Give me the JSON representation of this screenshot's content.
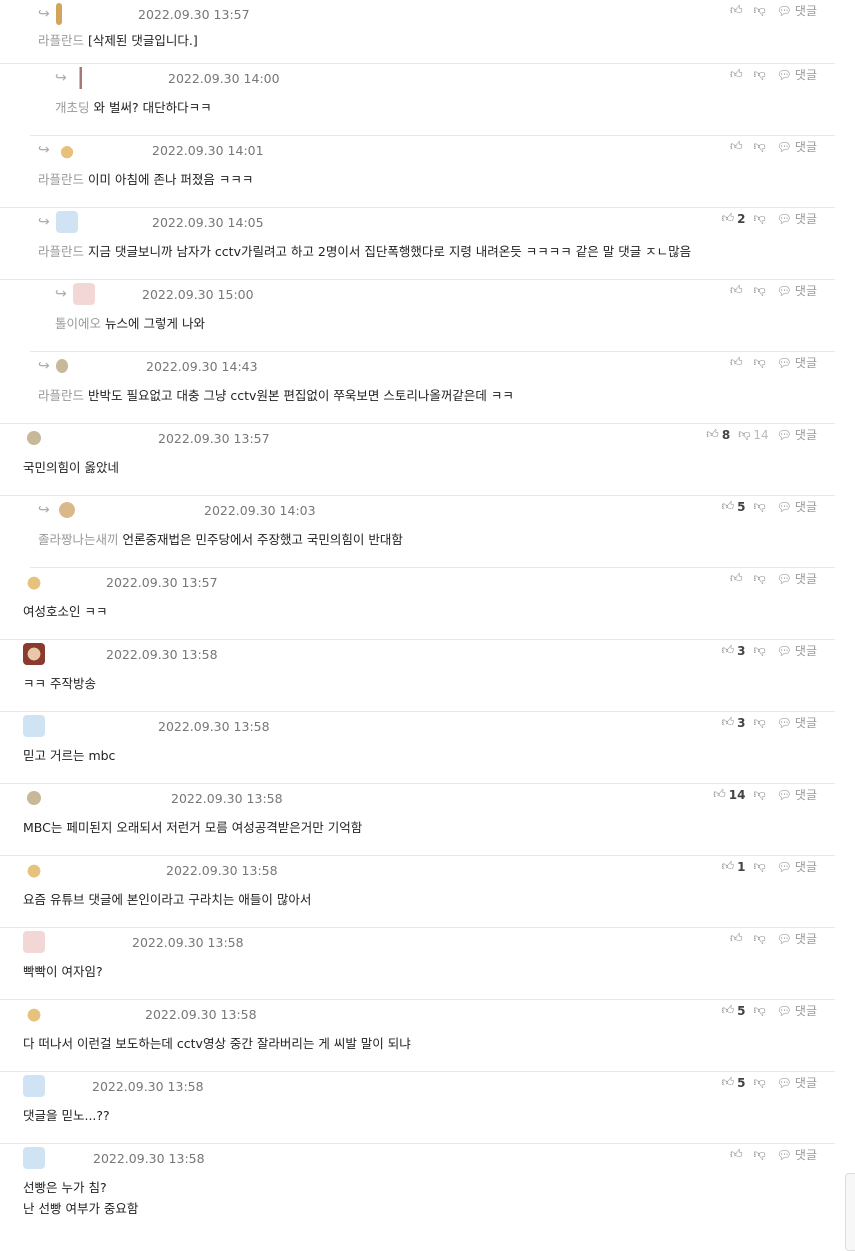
{
  "icons": {
    "like": "thumbs-up-icon",
    "dislike": "thumbs-down-icon",
    "reply": "speech-bubble-icon"
  },
  "reply_label": "댓글",
  "comments": [
    {
      "date": "2022.09.30 13:57",
      "nick": "라플란드",
      "text": "[삭제된 댓글입니다.]",
      "likes": "",
      "dislikes": ""
    },
    {
      "date": "2022.09.30 14:00",
      "nick": "개초딩",
      "text": "와 벌써? 대단하다ㅋㅋ",
      "likes": "",
      "dislikes": ""
    },
    {
      "date": "2022.09.30 14:01",
      "nick": "라플란드",
      "text": "이미 아침에 존나 퍼졌음 ㅋㅋㅋ",
      "likes": "",
      "dislikes": ""
    },
    {
      "date": "2022.09.30 14:05",
      "nick": "라플란드",
      "text": "지금 댓글보니까 남자가 cctv가릴려고 하고 2명이서 집단폭행했다로 지령 내려온듯 ㅋㅋㅋㅋ 같은 말 댓글 ㅈㄴ많음",
      "likes": "2",
      "dislikes": ""
    },
    {
      "date": "2022.09.30 15:00",
      "nick": "톨이에오",
      "text": "뉴스에 그렇게 나와",
      "likes": "",
      "dislikes": ""
    },
    {
      "date": "2022.09.30 14:43",
      "nick": "라플란드",
      "text": "반박도 필요없고 대충 그냥 cctv원본 편집없이 쭈욱보면 스토리나올꺼같은데 ㅋㅋ",
      "likes": "",
      "dislikes": ""
    },
    {
      "date": "2022.09.30 13:57",
      "nick": "",
      "text": "국민의힘이 옳았네",
      "likes": "8",
      "dislikes": "14"
    },
    {
      "date": "2022.09.30 14:03",
      "nick": "졸라짱나는새끼",
      "text": "언론중재법은 민주당에서 주장했고 국민의힘이 반대함",
      "likes": "5",
      "dislikes": ""
    },
    {
      "date": "2022.09.30 13:57",
      "nick": "",
      "text": "여성호소인 ㅋㅋ",
      "likes": "",
      "dislikes": ""
    },
    {
      "date": "2022.09.30 13:58",
      "nick": "",
      "text": "ㅋㅋ 주작방송",
      "likes": "3",
      "dislikes": ""
    },
    {
      "date": "2022.09.30 13:58",
      "nick": "",
      "text": "믿고 거르는 mbc",
      "likes": "3",
      "dislikes": ""
    },
    {
      "date": "2022.09.30 13:58",
      "nick": "",
      "text": "MBC는 페미된지 오래되서 저런거 모름 여성공격받은거만 기억함",
      "likes": "14",
      "dislikes": ""
    },
    {
      "date": "2022.09.30 13:58",
      "nick": "",
      "text": "요즘 유튜브 댓글에 본인이라고 구라치는 애들이 많아서",
      "likes": "1",
      "dislikes": ""
    },
    {
      "date": "2022.09.30 13:58",
      "nick": "",
      "text": "빡빡이 여자임?",
      "likes": "",
      "dislikes": ""
    },
    {
      "date": "2022.09.30 13:58",
      "nick": "",
      "text": "다 떠나서 이런걸 보도하는데 cctv영상 중간 잘라버리는 게 씨발 말이 되냐",
      "likes": "5",
      "dislikes": ""
    },
    {
      "date": "2022.09.30 13:58",
      "nick": "",
      "text": "댓글을 믿노...??",
      "likes": "5",
      "dislikes": ""
    },
    {
      "date": "2022.09.30 13:58",
      "nick": "",
      "text": "선빵은 누가 침?",
      "text2": "난 선빵 여부가 중요함",
      "likes": "",
      "dislikes": ""
    }
  ]
}
